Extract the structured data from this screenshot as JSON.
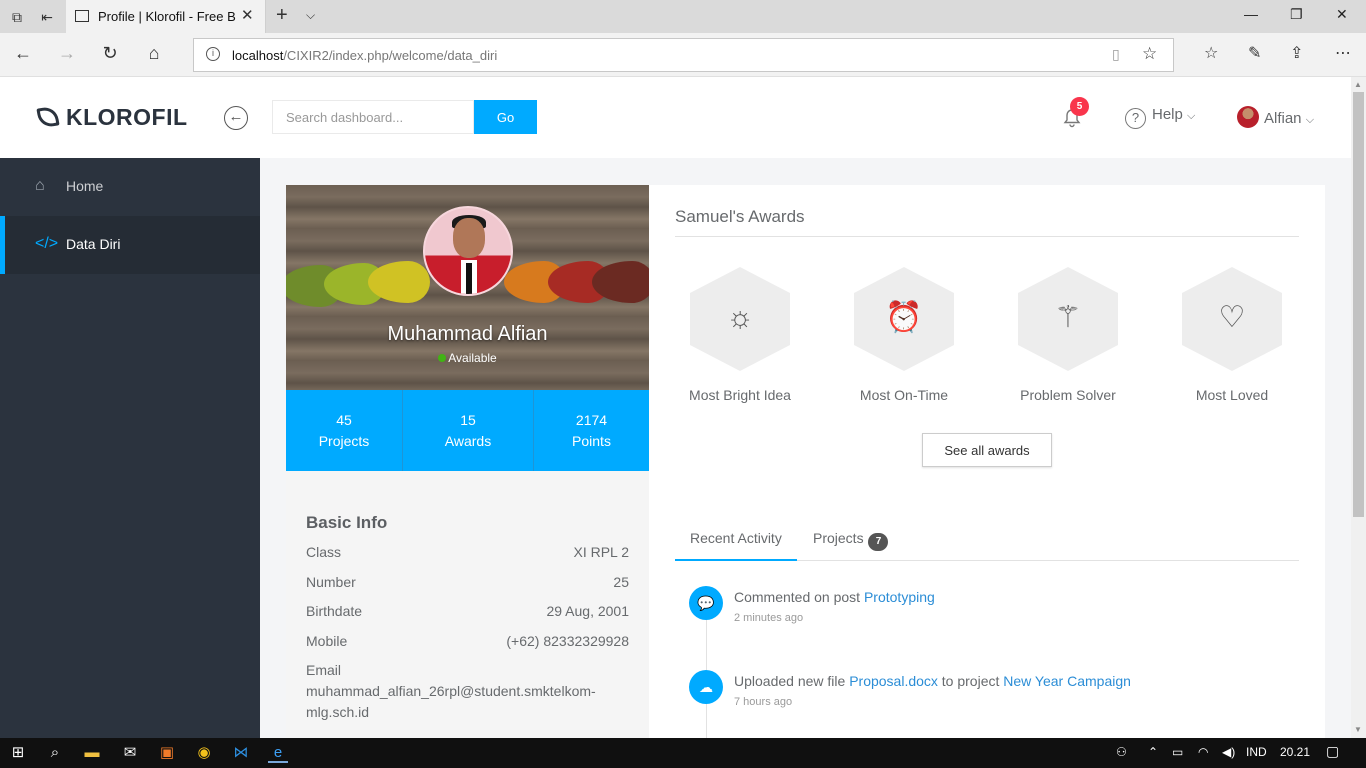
{
  "browser": {
    "tab_title": "Profile | Klorofil - Free B",
    "url_host": "localhost",
    "url_path": "/CIXIR2/index.php/welcome/data_diri"
  },
  "navbar": {
    "brand": "KLOROFIL",
    "search_placeholder": "Search dashboard...",
    "search_button": "Go",
    "notification_count": "5",
    "help_label": "Help",
    "user_name": "Alfian"
  },
  "sidebar": {
    "items": [
      {
        "label": "Home",
        "icon": "home-icon"
      },
      {
        "label": "Data Diri",
        "icon": "code-icon",
        "active": true
      }
    ]
  },
  "profile": {
    "name": "Muhammad Alfian",
    "status": "Available",
    "stats": [
      {
        "value": "45",
        "label": "Projects"
      },
      {
        "value": "15",
        "label": "Awards"
      },
      {
        "value": "2174",
        "label": "Points"
      }
    ],
    "basic_info": {
      "heading": "Basic Info",
      "class_label": "Class",
      "class_value": "XI RPL 2",
      "number_label": "Number",
      "number_value": "25",
      "birthdate_label": "Birthdate",
      "birthdate_value": "29 Aug, 2001",
      "mobile_label": "Mobile",
      "mobile_value": "(+62) 82332329928",
      "email_label": "Email",
      "email_line1": "muhammad_alfian_26rpl@student.smktelkom-",
      "email_line2": "mlg.sch.id"
    }
  },
  "awards": {
    "title": "Samuel's Awards",
    "items": [
      {
        "label": "Most Bright Idea",
        "icon": "sun-icon"
      },
      {
        "label": "Most On-Time",
        "icon": "alarm-clock-icon"
      },
      {
        "label": "Problem Solver",
        "icon": "magic-wand-icon"
      },
      {
        "label": "Most Loved",
        "icon": "heart-icon"
      }
    ],
    "see_all": "See all awards"
  },
  "tabs": {
    "recent": "Recent Activity",
    "projects": "Projects",
    "projects_count": "7"
  },
  "activity": [
    {
      "prefix": "Commented on post ",
      "link": "Prototyping",
      "time": "2 minutes ago"
    },
    {
      "prefix": "Uploaded new file ",
      "link": "Proposal.docx",
      "middle": " to project ",
      "link2": "New Year Campaign",
      "time": "7 hours ago"
    }
  ],
  "taskbar": {
    "language": "IND",
    "clock": "20.21"
  }
}
